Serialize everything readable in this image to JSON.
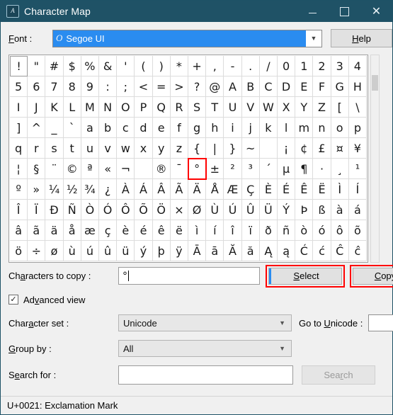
{
  "window": {
    "title": "Character Map",
    "app_icon": "character-map-icon",
    "controls": {
      "minimize": "minimize-icon",
      "maximize": "maximize-icon",
      "close": "close-icon"
    },
    "titlebar_color": "#1f5266"
  },
  "font_row": {
    "label": "Font :",
    "label_prefix": "F",
    "label_rest": "ont :",
    "selected_font": "Segoe UI",
    "tt_icon": "O",
    "dropdown_icon": "chevron-down-icon",
    "help_label": "Help",
    "help_prefix": "H",
    "help_rest": "elp",
    "selection_color": "#2a8cf0"
  },
  "grid": {
    "columns": 20,
    "focused_index": 0,
    "highlighted_char": "°",
    "highlight_color": "#ff0000",
    "rows": [
      [
        "!",
        "\"",
        "#",
        "$",
        "%",
        "&",
        "'",
        "(",
        ")",
        "*",
        "+",
        ",",
        "-",
        ".",
        "/",
        "0",
        "1",
        "2",
        "3",
        "4"
      ],
      [
        "5",
        "6",
        "7",
        "8",
        "9",
        ":",
        ";",
        "<",
        "=",
        ">",
        "?",
        "@",
        "A",
        "B",
        "C",
        "D",
        "E",
        "F",
        "G",
        "H"
      ],
      [
        "I",
        "J",
        "K",
        "L",
        "M",
        "N",
        "O",
        "P",
        "Q",
        "R",
        "S",
        "T",
        "U",
        "V",
        "W",
        "X",
        "Y",
        "Z",
        "[",
        "\\"
      ],
      [
        "]",
        "^",
        "_",
        "`",
        "a",
        "b",
        "c",
        "d",
        "e",
        "f",
        "g",
        "h",
        "i",
        "j",
        "k",
        "l",
        "m",
        "n",
        "o",
        "p"
      ],
      [
        "q",
        "r",
        "s",
        "t",
        "u",
        "v",
        "w",
        "x",
        "y",
        "z",
        "{",
        "|",
        "}",
        "~",
        " ",
        "¡",
        "¢",
        "£",
        "¤",
        "¥"
      ],
      [
        "¦",
        "§",
        "¨",
        "©",
        "ª",
        "«",
        "¬",
        "­",
        "®",
        "¯",
        "°",
        "±",
        "²",
        "³",
        "´",
        "µ",
        "¶",
        "·",
        "¸",
        "¹"
      ],
      [
        "º",
        "»",
        "¼",
        "½",
        "¾",
        "¿",
        "À",
        "Á",
        "Â",
        "Ã",
        "Ä",
        "Å",
        "Æ",
        "Ç",
        "È",
        "É",
        "Ê",
        "Ë",
        "Ì",
        "Í"
      ],
      [
        "Î",
        "Ï",
        "Ð",
        "Ñ",
        "Ò",
        "Ó",
        "Ô",
        "Õ",
        "Ö",
        "×",
        "Ø",
        "Ù",
        "Ú",
        "Û",
        "Ü",
        "Ý",
        "Þ",
        "ß",
        "à",
        "á"
      ],
      [
        "â",
        "ã",
        "ä",
        "å",
        "æ",
        "ç",
        "è",
        "é",
        "ê",
        "ë",
        "ì",
        "í",
        "î",
        "ï",
        "ð",
        "ñ",
        "ò",
        "ó",
        "ô",
        "õ"
      ],
      [
        "ö",
        "÷",
        "ø",
        "ù",
        "ú",
        "û",
        "ü",
        "ý",
        "þ",
        "ÿ",
        "Ā",
        "ā",
        "Ă",
        "ă",
        "Ą",
        "ą",
        "Ć",
        "ć",
        "Ĉ",
        "ĉ"
      ]
    ],
    "scrollbar": "vertical-scrollbar"
  },
  "copy_row": {
    "label": "Characters to copy :",
    "label_prefix": "Ch",
    "label_mid": "a",
    "label_rest": "racters to copy :",
    "field_value": "°",
    "field_placeholder": "",
    "select_label": "Select",
    "select_prefix": "S",
    "select_rest": "elect",
    "copy_label": "Copy",
    "copy_prefix": "C",
    "copy_rest": "opy"
  },
  "advanced_view": {
    "label": "Advanced view",
    "label_prefix": "Ad",
    "label_mid": "v",
    "label_rest": "anced view",
    "checked": true,
    "check_glyph": "✓"
  },
  "character_set": {
    "label": "Character set :",
    "label_prefix": "Char",
    "label_mid": "a",
    "label_rest": "cter set :",
    "value": "Unicode",
    "dropdown_icon": "chevron-down-icon"
  },
  "goto_unicode": {
    "label": "Go to Unicode :",
    "label_prefix": "Go to ",
    "label_mid": "U",
    "label_rest": "nicode :",
    "value": "",
    "placeholder": ""
  },
  "group_by": {
    "label": "Group by :",
    "label_prefix": "G",
    "label_rest": "roup by :",
    "value": "All",
    "dropdown_icon": "chevron-down-icon"
  },
  "search": {
    "label": "Search for :",
    "label_prefix": "S",
    "label_mid": "e",
    "label_rest": "arch for :",
    "value": "",
    "placeholder": "",
    "button_label": "Search",
    "button_prefix": "Sea",
    "button_mid": "r",
    "button_rest": "ch",
    "button_enabled": false
  },
  "status_bar": {
    "text": "U+0021: Exclamation Mark"
  }
}
